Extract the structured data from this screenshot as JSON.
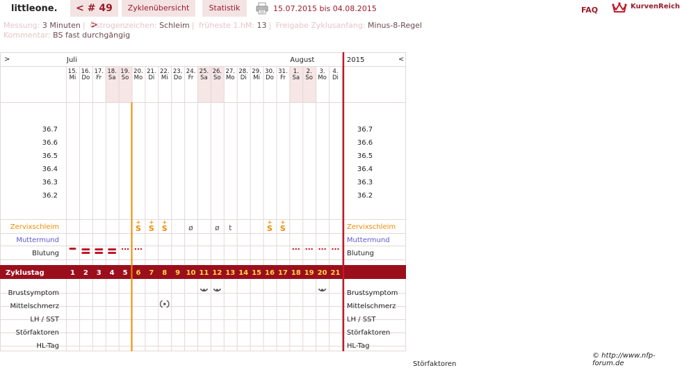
{
  "app": {
    "logo": "littleone.",
    "cycle_prev": "<",
    "cycle_label": "# 49",
    "cycle_next": ">",
    "tab_overview": "Zyklenübersicht",
    "tab_stats": "Statistik",
    "date_range": "15.07.2015 bis 04.08.2015",
    "faq": "FAQ",
    "kurvenreich": "KurvenReich",
    "icons": [
      "printer-icon",
      "kurvenreich-crown-icon"
    ]
  },
  "info": {
    "messung_label": "Messung:",
    "messung_value": "3 Minuten",
    "oestrogen_label": "Östrogenzeichen:",
    "oestrogen_value": "Schleim",
    "frueheste_label": "früheste 1.hM:",
    "frueheste_value": "13",
    "freigabe_label": "Freigabe Zyklusanfang:",
    "freigabe_value": "Minus-8-Regel",
    "kommentar_label": "Kommentar:",
    "kommentar_value": "BS fast durchgängig"
  },
  "chart_data": {
    "type": "table",
    "nav_left": ">",
    "nav_right": "<",
    "months": [
      {
        "label": "Juli",
        "start_index": 0
      },
      {
        "label": "August",
        "start_index": 17
      }
    ],
    "year": "2015",
    "days": [
      {
        "date": "15.",
        "wd": "Mi"
      },
      {
        "date": "16.",
        "wd": "Do"
      },
      {
        "date": "17.",
        "wd": "Fr"
      },
      {
        "date": "18.",
        "wd": "Sa"
      },
      {
        "date": "19.",
        "wd": "So"
      },
      {
        "date": "20.",
        "wd": "Mo"
      },
      {
        "date": "21.",
        "wd": "Di"
      },
      {
        "date": "22.",
        "wd": "Mi"
      },
      {
        "date": "23.",
        "wd": "Do"
      },
      {
        "date": "24.",
        "wd": "Fr"
      },
      {
        "date": "25.",
        "wd": "Sa"
      },
      {
        "date": "26.",
        "wd": "So"
      },
      {
        "date": "27.",
        "wd": "Mo"
      },
      {
        "date": "28.",
        "wd": "Di"
      },
      {
        "date": "29.",
        "wd": "Mi"
      },
      {
        "date": "30.",
        "wd": "Do"
      },
      {
        "date": "31.",
        "wd": "Fr"
      },
      {
        "date": "1.",
        "wd": "Sa"
      },
      {
        "date": "2.",
        "wd": "So"
      },
      {
        "date": "3.",
        "wd": "Mo"
      },
      {
        "date": "4.",
        "wd": "Di"
      }
    ],
    "weekend_indices": [
      3,
      4,
      10,
      11,
      17,
      18
    ],
    "temp_ticks": [
      "36.7",
      "36.6",
      "36.5",
      "36.4",
      "36.3",
      "36.2"
    ],
    "temperatures": [],
    "rows": {
      "zervix_label": "Zervixschleim",
      "muttermund_label": "Muttermund",
      "blutung_label": "Blutung",
      "zyklustag_label": "Zyklustag",
      "brust_label": "Brustsymptom",
      "mittel_label": "Mittelschmerz",
      "lh_label": "LH / SST",
      "stoer_label": "Störfaktoren",
      "hl_label": "HL-Tag"
    },
    "cycle_days": [
      "1",
      "2",
      "3",
      "4",
      "5",
      "6",
      "7",
      "8",
      "9",
      "10",
      "11",
      "12",
      "13",
      "14",
      "15",
      "16",
      "17",
      "18",
      "19",
      "20",
      "21"
    ],
    "zervix_marks": [
      {
        "day_index": 5,
        "symbol": "S+"
      },
      {
        "day_index": 6,
        "symbol": "S+"
      },
      {
        "day_index": 7,
        "symbol": "S+"
      },
      {
        "day_index": 9,
        "symbol": "ø"
      },
      {
        "day_index": 11,
        "symbol": "ø"
      },
      {
        "day_index": 12,
        "symbol": "t"
      },
      {
        "day_index": 15,
        "symbol": "S+"
      },
      {
        "day_index": 16,
        "symbol": "S+"
      }
    ],
    "bleeding": [
      {
        "day_index": 0,
        "level": "light-bar"
      },
      {
        "day_index": 1,
        "level": "heavy"
      },
      {
        "day_index": 2,
        "level": "heavy"
      },
      {
        "day_index": 3,
        "level": "medium"
      },
      {
        "day_index": 4,
        "level": "spotting"
      },
      {
        "day_index": 5,
        "level": "spotting"
      },
      {
        "day_index": 17,
        "level": "spotting"
      },
      {
        "day_index": 18,
        "level": "spotting"
      },
      {
        "day_index": 19,
        "level": "spotting"
      },
      {
        "day_index": 20,
        "level": "spotting"
      }
    ],
    "brust_marks": [
      10,
      11,
      19
    ],
    "mittel_marks": [
      7
    ],
    "cover_line_after_index": 4,
    "colors": {
      "accent": "#9b1b2b",
      "orange": "#f08a00",
      "muttermund": "#5a5ad0",
      "zyklus_bg": "#9b0f1c",
      "weekend_bg": "#f6e6e6",
      "grid": "#e4d7d7"
    }
  },
  "footer": {
    "copyright": "© http://www.nfp-forum.de",
    "cut_text": "Störfaktoren"
  }
}
